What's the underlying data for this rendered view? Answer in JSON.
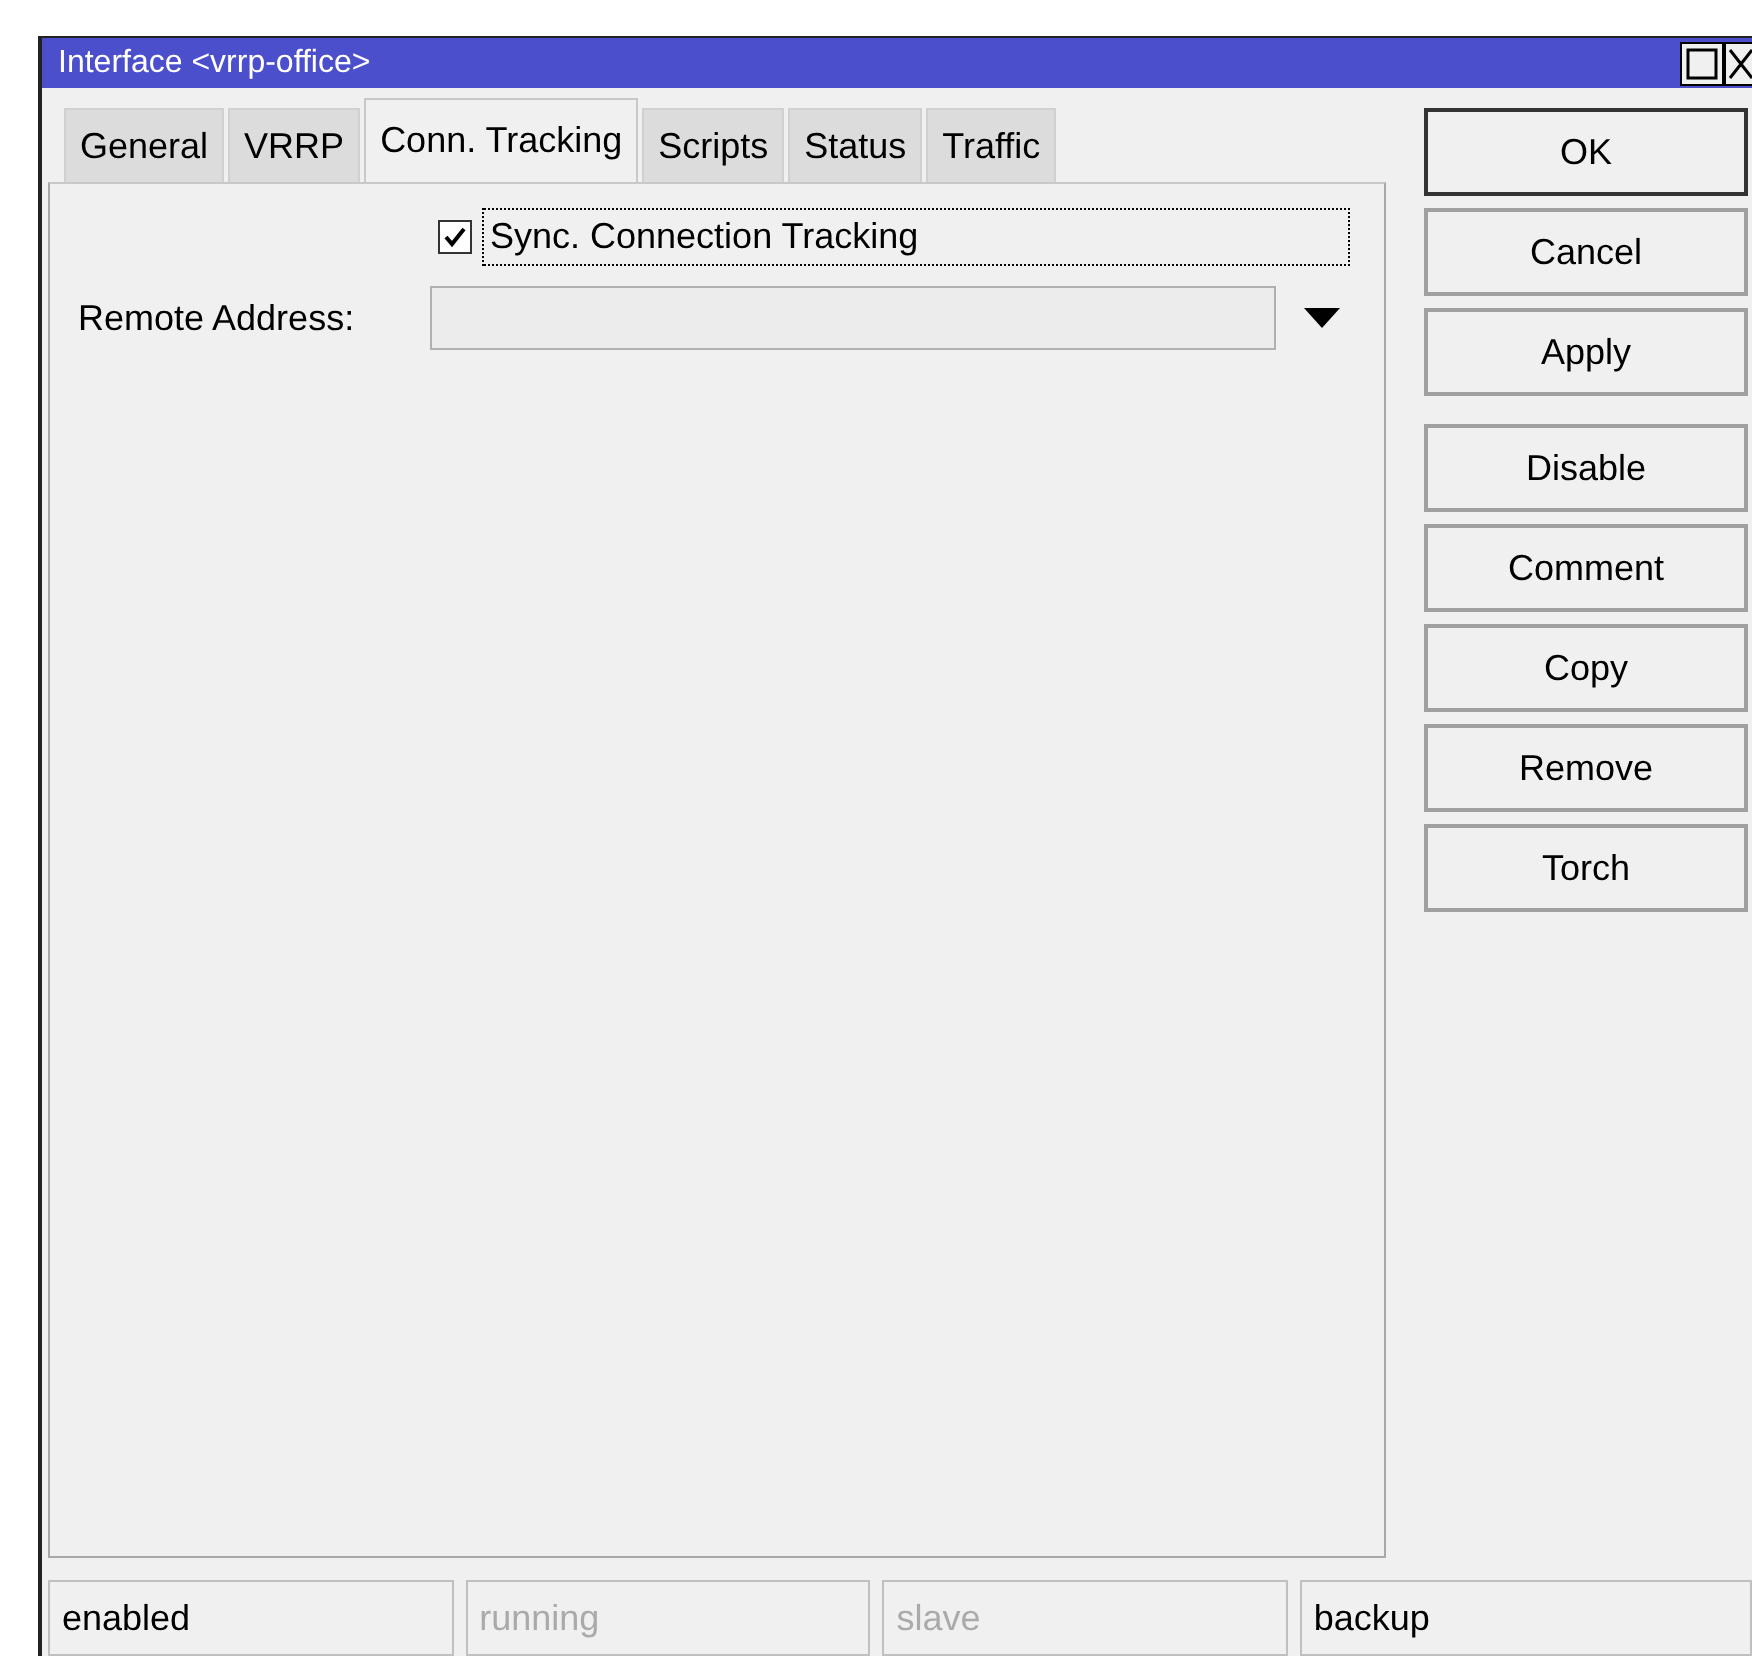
{
  "window": {
    "title": "Interface <vrrp-office>"
  },
  "tabs": [
    {
      "label": "General",
      "selected": false
    },
    {
      "label": "VRRP",
      "selected": false
    },
    {
      "label": "Conn. Tracking",
      "selected": true
    },
    {
      "label": "Scripts",
      "selected": false
    },
    {
      "label": "Status",
      "selected": false
    },
    {
      "label": "Traffic",
      "selected": false
    }
  ],
  "sync_checkbox": {
    "label": "Sync. Connection Tracking",
    "checked": true,
    "focused": true
  },
  "remote_address": {
    "label": "Remote Address:"
  },
  "dialog_buttons": [
    {
      "label": "OK",
      "default": true
    },
    {
      "label": "Cancel",
      "default": false
    },
    {
      "label": "Apply",
      "default": false
    }
  ],
  "action_buttons": [
    {
      "label": "Disable"
    },
    {
      "label": "Comment"
    },
    {
      "label": "Copy"
    },
    {
      "label": "Remove"
    },
    {
      "label": "Torch"
    }
  ],
  "status_bar": [
    {
      "text": "enabled",
      "active": true
    },
    {
      "text": "running",
      "active": false
    },
    {
      "text": "slave",
      "active": false
    },
    {
      "text": "backup",
      "active": true
    }
  ]
}
